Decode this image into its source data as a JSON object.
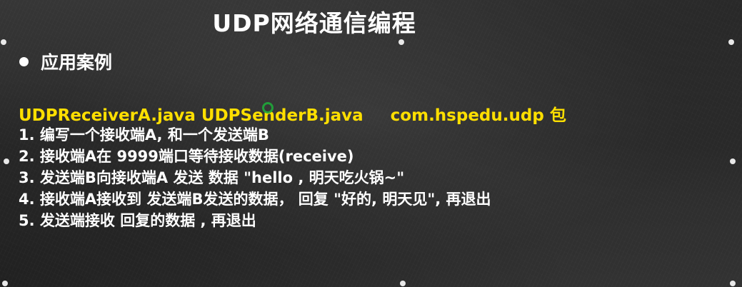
{
  "slide": {
    "title": "UDP网络通信编程",
    "section_heading": "应用案例",
    "files": {
      "receiver": "UDPReceiverA.java",
      "sender": "UDPSenderB.java",
      "package": "com.hspedu.udp 包"
    },
    "steps": [
      "1. 编写一个接收端A, 和一个发送端B",
      "2. 接收端A在 9999端口等待接收数据(receive)",
      "3. 发送端B向接收端A 发送 数据 \"hello , 明天吃火锅~\"",
      "4. 接收端A接收到 发送端B发送的数据， 回复 \"好的, 明天见\", 再退出",
      "5. 发送端接收 回复的数据 , 再退出"
    ]
  },
  "colors": {
    "background": "#2f2f2f",
    "text": "#ffffff",
    "highlight": "#ffdf00",
    "cursor": "#1fa83a"
  },
  "icons": {
    "bullet": "filled-circle",
    "selection_handles": "white-dots",
    "cursor": "green-ring"
  }
}
